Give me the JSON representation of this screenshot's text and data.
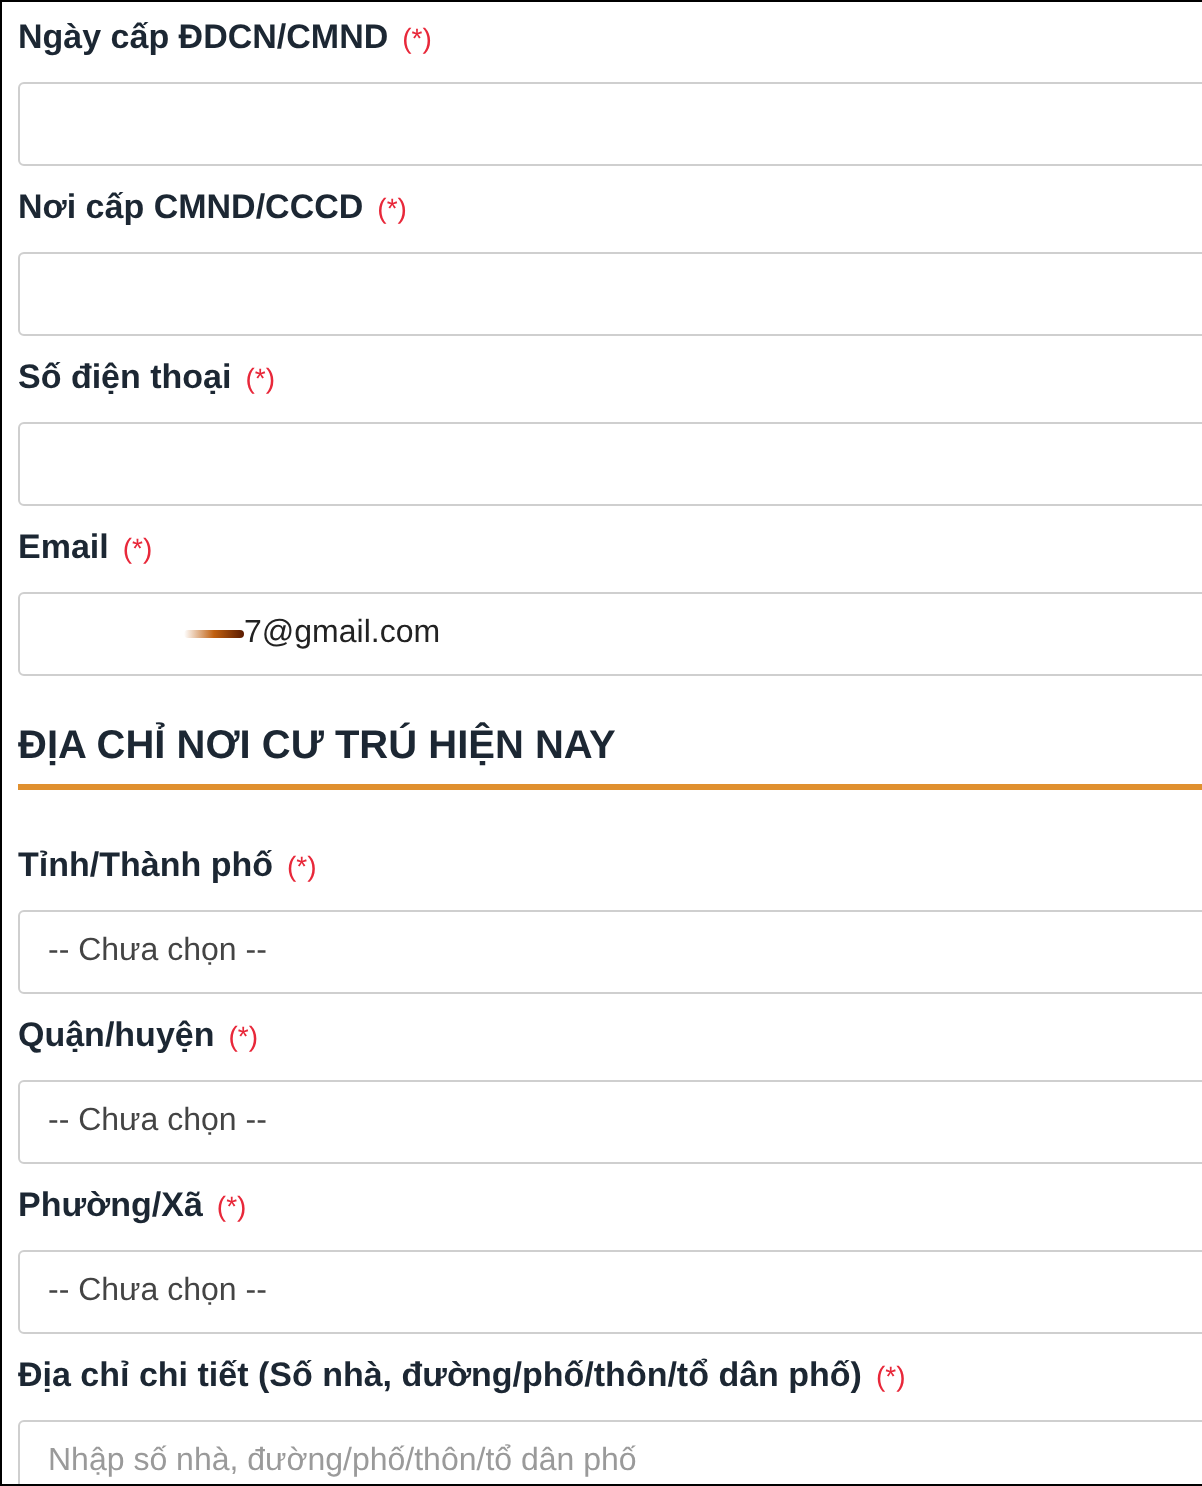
{
  "form": [
    {
      "kind": "field",
      "label": "Ngày cấp ĐDCN/CMND",
      "required": "(*)",
      "input": {
        "kind": "text"
      }
    },
    {
      "kind": "field",
      "label": "Nơi cấp CMND/CCCD",
      "required": "(*)",
      "input": {
        "kind": "text"
      }
    },
    {
      "kind": "field",
      "label": "Số điện thoại",
      "required": "(*)",
      "input": {
        "kind": "text"
      }
    },
    {
      "kind": "field",
      "label": "Email",
      "required": "(*)",
      "input": {
        "kind": "text",
        "redacted": true,
        "value": "7@gmail.com"
      }
    },
    {
      "kind": "section",
      "title": "ĐỊA CHỈ NƠI CƯ TRÚ HIỆN NAY"
    },
    {
      "kind": "field",
      "label": "Tỉnh/Thành phố",
      "required": "(*)",
      "input": {
        "kind": "select",
        "value": "-- Chưa chọn --"
      }
    },
    {
      "kind": "field",
      "label": "Quận/huyện",
      "required": "(*)",
      "input": {
        "kind": "select",
        "value": "-- Chưa chọn --"
      }
    },
    {
      "kind": "field",
      "label": "Phường/Xã",
      "required": "(*)",
      "input": {
        "kind": "select",
        "value": "-- Chưa chọn --"
      }
    },
    {
      "kind": "field",
      "label": "Địa chỉ chi tiết (Số nhà, đường/phố/thôn/tổ dân phố)",
      "required": "(*)",
      "input": {
        "kind": "text",
        "placeholder": "Nhập số nhà, đường/phố/thôn/tổ dân phố"
      }
    }
  ]
}
